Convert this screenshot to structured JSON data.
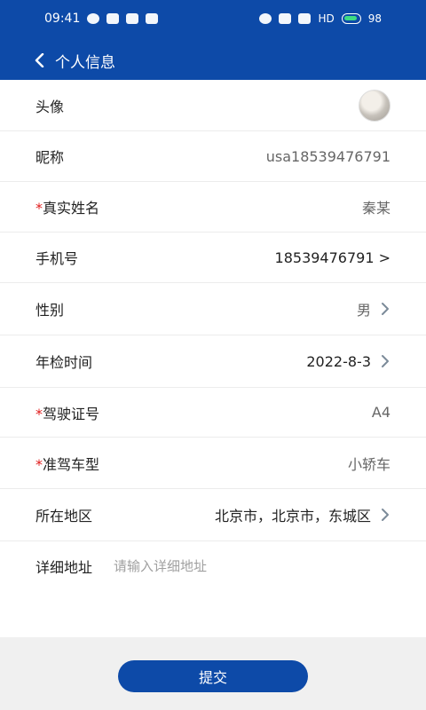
{
  "status_bar": {
    "time": "09:41",
    "left_icons": [
      "chat-icon",
      "image-icon",
      "usb-icon",
      "android-icon"
    ],
    "right_icons": [
      "alarm-icon",
      "wifi-icon",
      "signal-icon"
    ],
    "network_label": "HD",
    "battery_level": "98"
  },
  "header": {
    "title": "个人信息"
  },
  "rows": [
    {
      "label": "头像",
      "required": false,
      "value": "",
      "has_chevron": false,
      "value_color": "gray"
    },
    {
      "label": "昵称",
      "required": false,
      "value": "usa18539476791",
      "has_chevron": false,
      "value_color": "gray"
    },
    {
      "label": "真实姓名",
      "required": true,
      "value": "秦某",
      "has_chevron": false,
      "value_color": "gray"
    },
    {
      "label": "手机号",
      "required": false,
      "value": "18539476791 >",
      "has_chevron": false,
      "value_color": "dark"
    },
    {
      "label": "性别",
      "required": false,
      "value": "男",
      "has_chevron": true,
      "value_color": "gray"
    },
    {
      "label": "年检时间",
      "required": false,
      "value": "2022-8-3",
      "has_chevron": true,
      "value_color": "dark"
    },
    {
      "label": "驾驶证号",
      "required": true,
      "value": "A4",
      "has_chevron": false,
      "value_color": "gray"
    },
    {
      "label": "准驾车型",
      "required": true,
      "value": "小轿车",
      "has_chevron": false,
      "value_color": "gray"
    },
    {
      "label": "所在地区",
      "required": false,
      "value": "北京市，北京市，东城区",
      "has_chevron": true,
      "value_color": "dark"
    }
  ],
  "address": {
    "label": "详细地址",
    "placeholder": "请输入详细地址",
    "value": ""
  },
  "footer": {
    "submit_label": "提交"
  },
  "colors": {
    "primary": "#0d4aa8",
    "required": "#e01b1b",
    "background": "#f0f0f0"
  }
}
